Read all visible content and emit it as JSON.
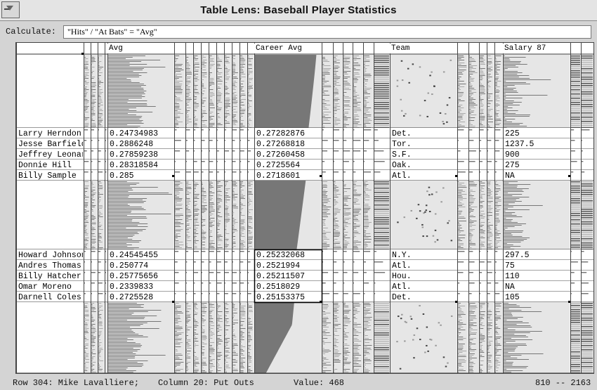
{
  "window": {
    "title": "Table Lens: Baseball Player Statistics"
  },
  "calculate": {
    "label": "Calculate:",
    "expression": "\"Hits\" / \"At Bats\" = \"Avg\""
  },
  "columns": {
    "avg": "Avg",
    "career_avg": "Career Avg",
    "team": "Team",
    "salary": "Salary 87"
  },
  "focus_group_1": [
    {
      "name": "Larry Herndon",
      "avg": "0.24734983",
      "career": "0.27282876",
      "team": "Det.",
      "salary": "225"
    },
    {
      "name": "Jesse Barfield",
      "avg": "0.2886248",
      "career": "0.27268818",
      "team": "Tor.",
      "salary": "1237.5"
    },
    {
      "name": "Jeffrey Leonar",
      "avg": "0.27859238",
      "career": "0.27260458",
      "team": "S.F.",
      "salary": "900"
    },
    {
      "name": "Donnie Hill",
      "avg": "0.28318584",
      "career": "0.2725564",
      "team": "Oak.",
      "salary": "275"
    },
    {
      "name": "Billy Sample",
      "avg": "0.285",
      "career": "0.2718601",
      "team": "Atl.",
      "salary": "NA"
    }
  ],
  "focus_group_2": [
    {
      "name": "Howard Johnson",
      "avg": "0.24545455",
      "career": "0.25232068",
      "team": "N.Y.",
      "salary": "297.5"
    },
    {
      "name": "Andres Thomas",
      "avg": "0.250774",
      "career": "0.2521994",
      "team": "Atl.",
      "salary": "75"
    },
    {
      "name": "Billy Hatcher",
      "avg": "0.25775656",
      "career": "0.25211507",
      "team": "Hou.",
      "salary": "110"
    },
    {
      "name": "Omar Moreno",
      "avg": "0.2339833",
      "career": "0.2518029",
      "team": "Atl.",
      "salary": "NA"
    },
    {
      "name": "Darnell Coles",
      "avg": "0.2725528",
      "career": "0.25153375",
      "team": "Det.",
      "salary": "105"
    }
  ],
  "status": {
    "row": "Row 304: Mike Lavalliere;",
    "column": "Column 20: Put Outs",
    "value": "Value: 468",
    "range": "810 -- 2163"
  },
  "colors": {
    "bar": "#777777",
    "bar_light": "#a8a8a8",
    "background": "#e6e6e6",
    "window": "#d4d4d4"
  }
}
